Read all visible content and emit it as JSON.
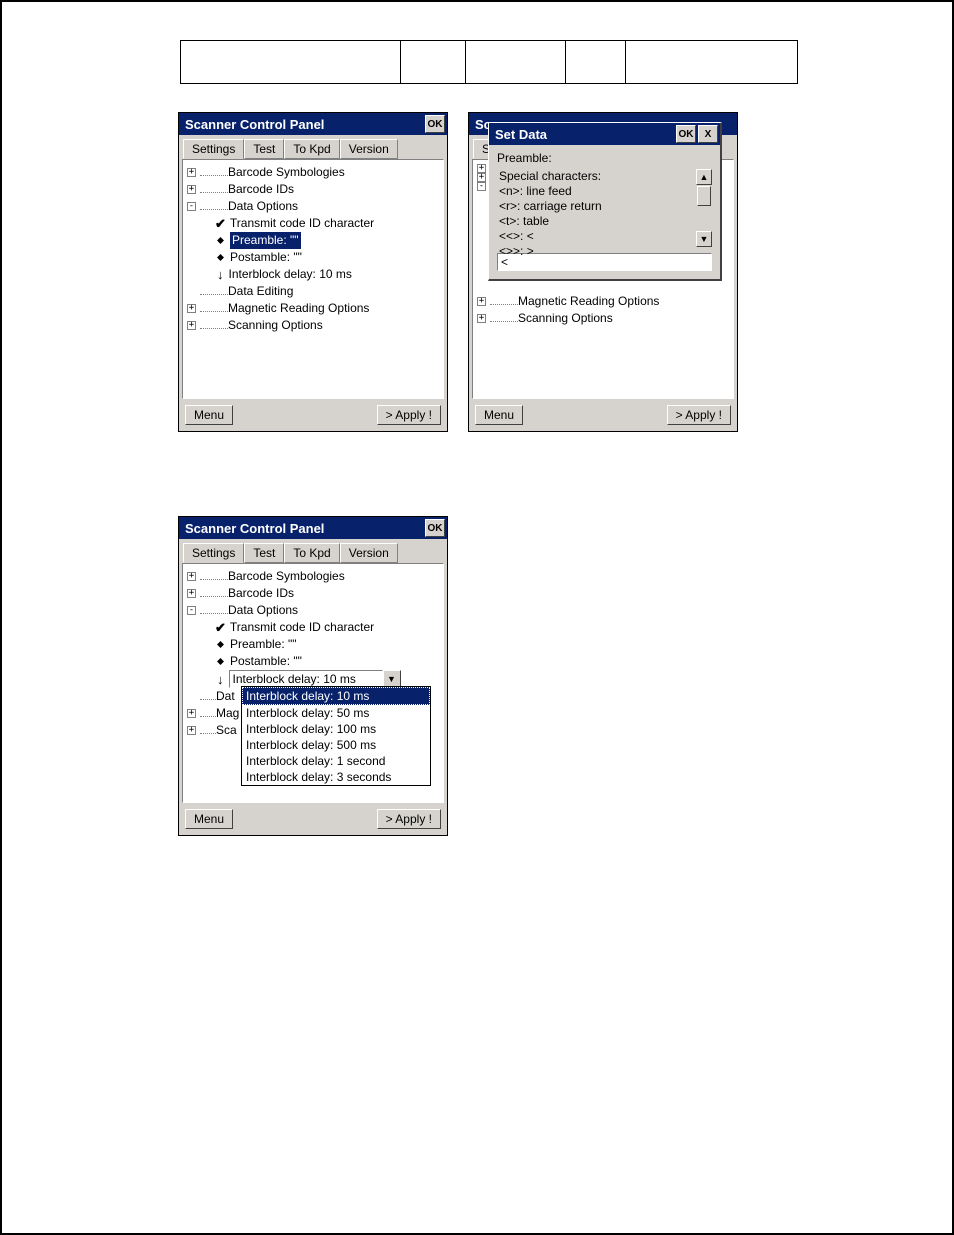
{
  "panel_a": {
    "title": "Scanner Control Panel",
    "ok": "OK",
    "tabs": [
      "Settings",
      "Test",
      "To Kpd",
      "Version"
    ],
    "active_tab": 0,
    "tree": {
      "items": [
        "Barcode Symbologies",
        "Barcode IDs",
        "Data Options",
        "Transmit code ID character",
        "Preamble: \"\"",
        "Postamble: \"\"",
        "Interblock delay: 10 ms",
        "Data Editing",
        "Magnetic Reading Options",
        "Scanning Options"
      ]
    },
    "menu": "Menu",
    "apply": "> Apply !"
  },
  "panel_b": {
    "title_bg": "Sc",
    "tab_bg": "Se",
    "tree_bg_mag": "Magnetic Reading Options",
    "tree_bg_scan": "Scanning Options",
    "menu": "Menu",
    "apply": "> Apply !",
    "dialog": {
      "title": "Set Data",
      "ok": "OK",
      "close": "X",
      "label": "Preamble:",
      "help": [
        "Special characters:",
        "<n>: line feed",
        "<r>: carriage return",
        "<t>: table",
        "<<>: <",
        "<>>: >"
      ],
      "input_value": "<"
    }
  },
  "panel_c": {
    "title": "Scanner Control Panel",
    "ok": "OK",
    "tabs": [
      "Settings",
      "Test",
      "To Kpd",
      "Version"
    ],
    "active_tab": 0,
    "tree": {
      "items": [
        "Barcode Symbologies",
        "Barcode IDs",
        "Data Options",
        "Transmit code ID character",
        "Preamble: \"\"",
        "Postamble: \"\""
      ],
      "combo_value": "Interblock delay: 10 ms",
      "truncated": [
        "Dat",
        "Mag",
        "Sca"
      ],
      "options": [
        "Interblock delay: 10 ms",
        "Interblock delay: 50 ms",
        "Interblock delay: 100 ms",
        "Interblock delay: 500 ms",
        "Interblock delay: 1 second",
        "Interblock delay: 3 seconds"
      ],
      "selected_option": 0
    },
    "menu": "Menu",
    "apply": "> Apply !"
  }
}
